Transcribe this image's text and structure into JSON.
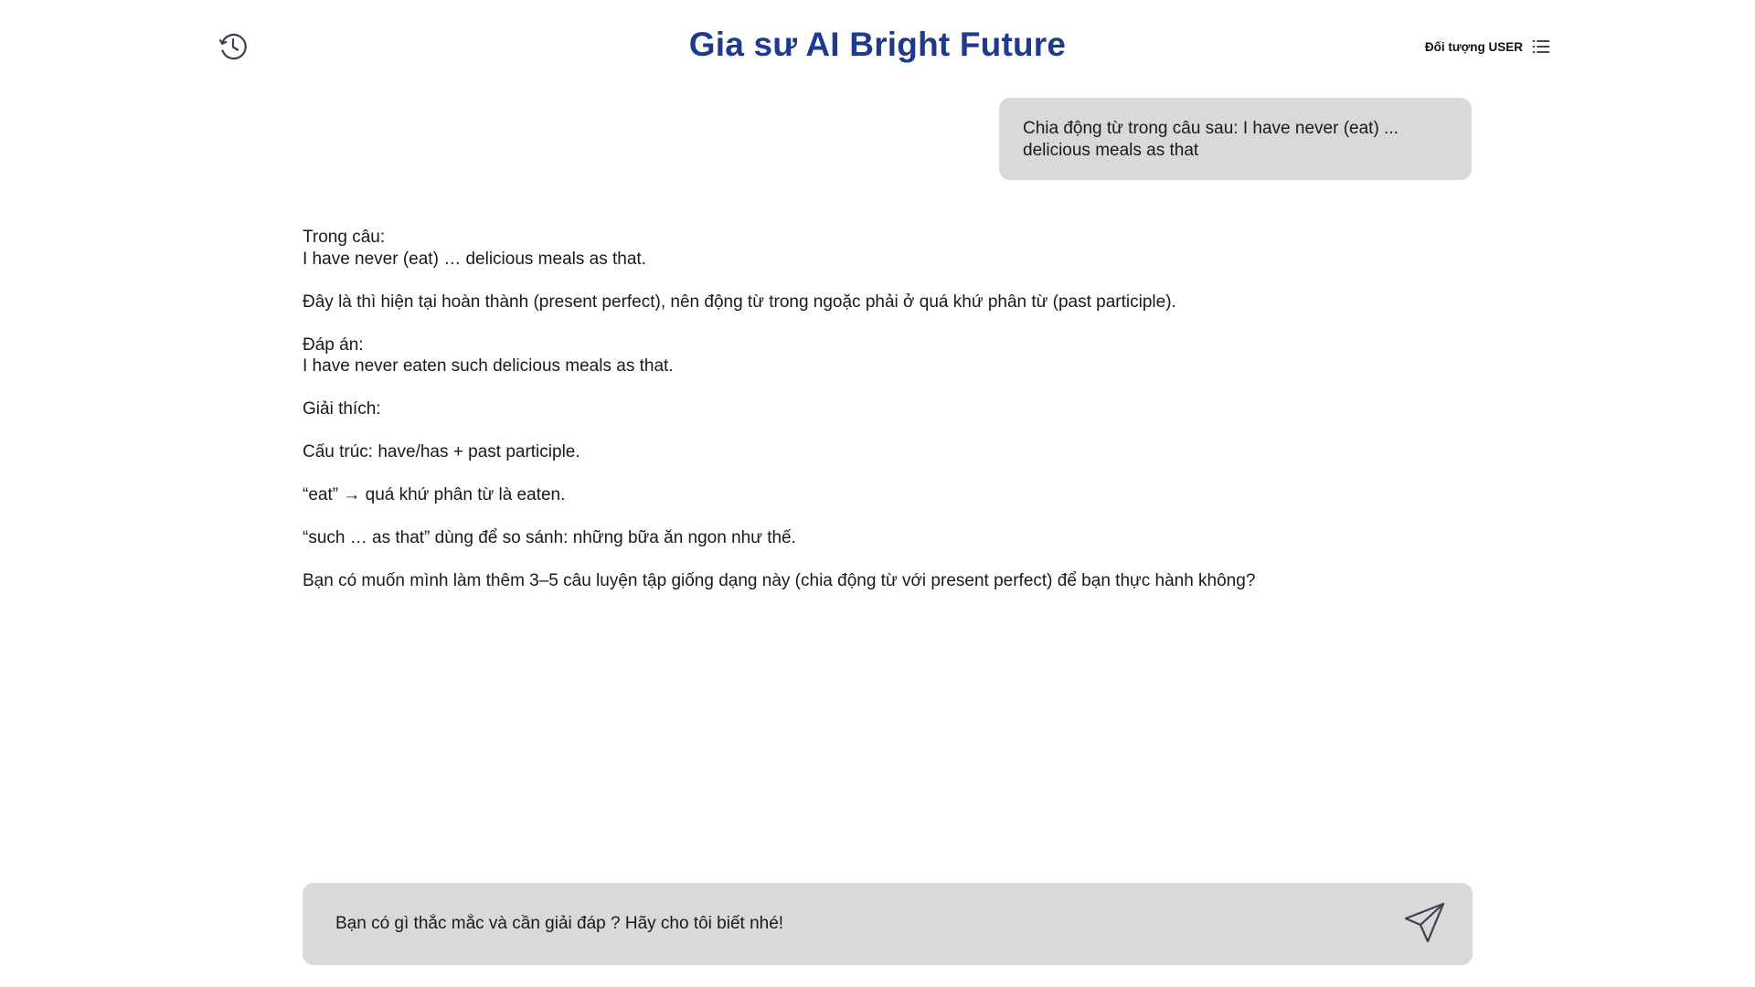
{
  "header": {
    "title": "Gia sư AI Bright Future",
    "user_target_label": "Đối tượng USER",
    "history_icon": "history-icon",
    "menu_icon": "list-menu-icon",
    "title_color": "#1f3a8a"
  },
  "chat": {
    "user_message": "Chia động từ trong câu sau: I have never (eat) ... delicious meals as that",
    "assistant_paragraphs": [
      [
        "Trong câu:",
        "I have never (eat) … delicious meals as that."
      ],
      [
        "Đây là thì hiện tại hoàn thành (present perfect), nên động từ trong ngoặc phải ở quá khứ phân từ (past participle)."
      ],
      [
        "Đáp án:",
        "I have never eaten such delicious meals as that."
      ],
      [
        "Giải thích:"
      ],
      [
        "Cấu trúc: have/has + past participle."
      ],
      [
        "“eat” → quá khứ phân từ là eaten."
      ],
      [
        "“such … as that” dùng để so sánh: những bữa ăn ngon như thế."
      ],
      [
        "Bạn có muốn mình làm thêm 3–5 câu luyện tập giống dạng này (chia động từ với present perfect) để bạn thực hành không?"
      ]
    ]
  },
  "input": {
    "placeholder": "Bạn có gì thắc mắc và cần giải đáp ? Hãy cho tôi biết nhé!",
    "value": "",
    "send_icon": "send-icon"
  },
  "colors": {
    "bubble_bg": "#d9d9d9",
    "text": "#1a1a1a"
  }
}
